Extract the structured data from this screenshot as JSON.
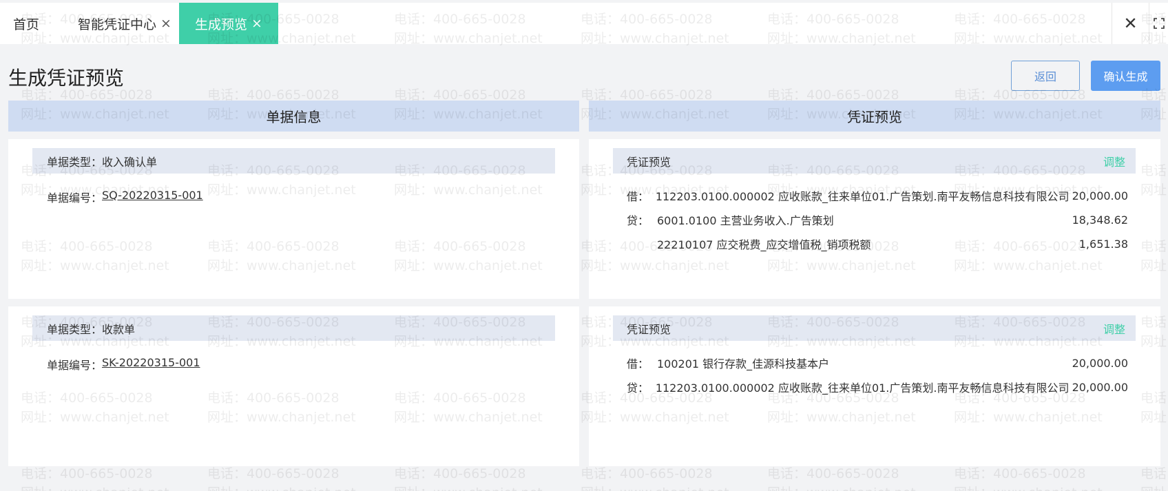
{
  "tabs": {
    "home": "首页",
    "center": "智能凭证中心",
    "preview": "生成预览",
    "close_glyph": "×"
  },
  "window": {
    "close": "✕"
  },
  "page": {
    "title": "生成凭证预览",
    "back_label": "返回",
    "confirm_label": "确认生成",
    "left_header": "单据信息",
    "right_header": "凭证预览"
  },
  "documents": [
    {
      "type_label": "单据类型：",
      "type_value": "收入确认单",
      "no_label": "单据编号：",
      "no_value": "SQ-20220315-001",
      "voucher_title": "凭证预览",
      "adjust_label": "调整",
      "lines": [
        {
          "dc": "借：",
          "account": "112203.0100.000002  应收账款_往来单位01.广告策划.南平友畅信息科技有限公司",
          "amount": "20,000.00"
        },
        {
          "dc": "贷：",
          "account": "6001.0100  主营业务收入.广告策划",
          "amount": "18,348.62"
        },
        {
          "dc": "",
          "account": "22210107  应交税费_应交增值税_销项税额",
          "amount": "1,651.38"
        }
      ]
    },
    {
      "type_label": "单据类型：",
      "type_value": "收款单",
      "no_label": "单据编号：",
      "no_value": "SK-20220315-001",
      "voucher_title": "凭证预览",
      "adjust_label": "调整",
      "lines": [
        {
          "dc": "借：",
          "account": "100201  银行存款_佳源科技基本户",
          "amount": "20,000.00"
        },
        {
          "dc": "贷：",
          "account": "112203.0100.000002  应收账款_往来单位01.广告策划.南平友畅信息科技有限公司",
          "amount": "20,000.00"
        }
      ]
    }
  ],
  "watermark": {
    "phone": "电话：400-665-0028",
    "site": "网址：www.chanjet.net"
  },
  "colors": {
    "accent": "#3fcfa8",
    "primary": "#5d9df0",
    "header_bg": "#cfdcf2",
    "bar_bg": "#e3e8f2"
  }
}
